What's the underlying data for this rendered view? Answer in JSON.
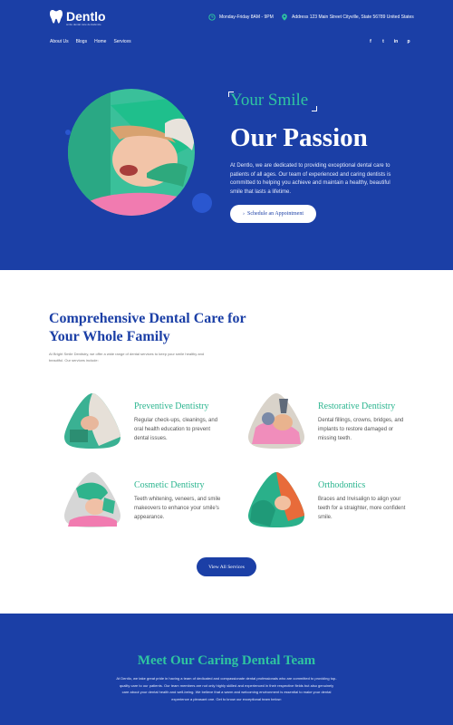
{
  "brand": {
    "name": "Dentlo",
    "tagline": "smile dental care dentalsmile",
    "accent": "#2fc5a0",
    "primary": "#1b3fa6"
  },
  "header": {
    "hours": {
      "icon": "clock-icon",
      "text": "Monday-Friday 8AM - 9PM"
    },
    "address": {
      "icon": "location-pin-icon",
      "text": "Address 123 Main Street Cityville, State 56789 United States"
    }
  },
  "nav": {
    "items": [
      "About Us",
      "Blogs",
      "Home",
      "Services"
    ]
  },
  "social": [
    {
      "icon": "facebook-icon",
      "glyph": "f"
    },
    {
      "icon": "twitter-icon",
      "glyph": "t"
    },
    {
      "icon": "linkedin-icon",
      "glyph": "in"
    },
    {
      "icon": "pinterest-icon",
      "glyph": "p"
    }
  ],
  "hero": {
    "eyebrow": "Your Smile",
    "title": "Our Passion",
    "body": "At Dentlo, we are dedicated to providing exceptional dental care to patients of all ages. Our team of experienced and caring dentists is committed to helping you achieve and maintain a healthy, beautiful smile that lasts a lifetime.",
    "cta": "Schedule an Appointment"
  },
  "services": {
    "title": "Comprehensive Dental Care for Your Whole Family",
    "intro": "At Bright Smile Dentistry, we offer a wide range of dental services to keep your smile healthy and beautiful. Our services include:",
    "items": [
      {
        "title": "Preventive Dentistry",
        "desc": "Regular check-ups, cleanings, and oral health education to prevent dental issues."
      },
      {
        "title": "Restorative Dentistry",
        "desc": "Dental fillings, crowns, bridges, and implants to restore damaged or missing teeth."
      },
      {
        "title": "Cosmetic Dentistry",
        "desc": "Teeth whitening, veneers, and smile makeovers to enhance your smile's appearance."
      },
      {
        "title": "Orthodontics",
        "desc": "Braces and Invisalign to align your teeth for a straighter, more confident smile."
      }
    ],
    "button": "View All Services"
  },
  "team": {
    "title": "Meet Our Caring Dental Team",
    "body": "At Dentlo, we take great pride in having a team of dedicated and compassionate dental professionals who are committed to providing top-quality care to our patients. Our team members are not only highly skilled and experienced in their respective fields but also genuinely care about your dental health and well-being. We believe that a warm and welcoming environment is essential to make your dental experience a pleasant one. Get to know our exceptional team below:"
  }
}
